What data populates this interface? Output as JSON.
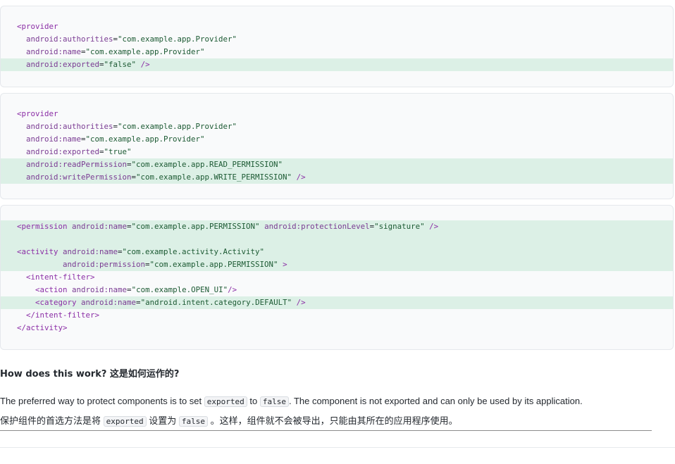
{
  "code_blocks": [
    {
      "lines": [
        {
          "indent": "",
          "parts": [
            {
              "t": "tag",
              "v": "<provider"
            }
          ],
          "hl": false
        },
        {
          "indent": "  ",
          "parts": [
            {
              "t": "attrn",
              "v": "android:authorities"
            },
            {
              "t": "punc",
              "v": "="
            },
            {
              "t": "str",
              "v": "\"com.example.app.Provider\""
            }
          ],
          "hl": false
        },
        {
          "indent": "  ",
          "parts": [
            {
              "t": "attrn",
              "v": "android:name"
            },
            {
              "t": "punc",
              "v": "="
            },
            {
              "t": "str",
              "v": "\"com.example.app.Provider\""
            }
          ],
          "hl": false
        },
        {
          "indent": "  ",
          "parts": [
            {
              "t": "attrn",
              "v": "android:exported"
            },
            {
              "t": "punc",
              "v": "="
            },
            {
              "t": "str",
              "v": "\"false\""
            },
            {
              "t": "tag",
              "v": " />"
            }
          ],
          "hl": true
        }
      ]
    },
    {
      "lines": [
        {
          "indent": "",
          "parts": [
            {
              "t": "tag",
              "v": "<provider"
            }
          ],
          "hl": false
        },
        {
          "indent": "  ",
          "parts": [
            {
              "t": "attrn",
              "v": "android:authorities"
            },
            {
              "t": "punc",
              "v": "="
            },
            {
              "t": "str",
              "v": "\"com.example.app.Provider\""
            }
          ],
          "hl": false
        },
        {
          "indent": "  ",
          "parts": [
            {
              "t": "attrn",
              "v": "android:name"
            },
            {
              "t": "punc",
              "v": "="
            },
            {
              "t": "str",
              "v": "\"com.example.app.Provider\""
            }
          ],
          "hl": false
        },
        {
          "indent": "  ",
          "parts": [
            {
              "t": "attrn",
              "v": "android:exported"
            },
            {
              "t": "punc",
              "v": "="
            },
            {
              "t": "str",
              "v": "\"true\""
            }
          ],
          "hl": false
        },
        {
          "indent": "  ",
          "parts": [
            {
              "t": "attrn",
              "v": "android:readPermission"
            },
            {
              "t": "punc",
              "v": "="
            },
            {
              "t": "str",
              "v": "\"com.example.app.READ_PERMISSION\""
            }
          ],
          "hl": true
        },
        {
          "indent": "  ",
          "parts": [
            {
              "t": "attrn",
              "v": "android:writePermission"
            },
            {
              "t": "punc",
              "v": "="
            },
            {
              "t": "str",
              "v": "\"com.example.app.WRITE_PERMISSION\""
            },
            {
              "t": "tag",
              "v": " />"
            }
          ],
          "hl": true
        }
      ]
    },
    {
      "lines": [
        {
          "indent": "",
          "parts": [
            {
              "t": "tag",
              "v": "<permission "
            },
            {
              "t": "attrn",
              "v": "android:name"
            },
            {
              "t": "punc",
              "v": "="
            },
            {
              "t": "str",
              "v": "\"com.example.app.PERMISSION\""
            },
            {
              "t": "punc",
              "v": " "
            },
            {
              "t": "attrn",
              "v": "android:protectionLevel"
            },
            {
              "t": "punc",
              "v": "="
            },
            {
              "t": "str",
              "v": "\"signature\""
            },
            {
              "t": "tag",
              "v": " />"
            }
          ],
          "hl": true
        },
        {
          "indent": "",
          "parts": [],
          "hl": true
        },
        {
          "indent": "",
          "parts": [
            {
              "t": "tag",
              "v": "<activity "
            },
            {
              "t": "attrn",
              "v": "android:name"
            },
            {
              "t": "punc",
              "v": "="
            },
            {
              "t": "str",
              "v": "\"com.example.activity.Activity\""
            }
          ],
          "hl": true
        },
        {
          "indent": "          ",
          "parts": [
            {
              "t": "attrn",
              "v": "android:permission"
            },
            {
              "t": "punc",
              "v": "="
            },
            {
              "t": "str",
              "v": "\"com.example.app.PERMISSION\""
            },
            {
              "t": "tag",
              "v": " >"
            }
          ],
          "hl": true
        },
        {
          "indent": "  ",
          "parts": [
            {
              "t": "tag",
              "v": "<intent-filter>"
            }
          ],
          "hl": false
        },
        {
          "indent": "    ",
          "parts": [
            {
              "t": "tag",
              "v": "<action "
            },
            {
              "t": "attrn",
              "v": "android:name"
            },
            {
              "t": "punc",
              "v": "="
            },
            {
              "t": "str",
              "v": "\"com.example.OPEN_UI\""
            },
            {
              "t": "tag",
              "v": "/>"
            }
          ],
          "hl": false
        },
        {
          "indent": "    ",
          "parts": [
            {
              "t": "tag",
              "v": "<category "
            },
            {
              "t": "attrn",
              "v": "android:name"
            },
            {
              "t": "punc",
              "v": "="
            },
            {
              "t": "str",
              "v": "\"android.intent.category.DEFAULT\""
            },
            {
              "t": "tag",
              "v": " />"
            }
          ],
          "hl": true
        },
        {
          "indent": "  ",
          "parts": [
            {
              "t": "tag",
              "v": "</intent-filter>"
            }
          ],
          "hl": false
        },
        {
          "indent": "",
          "parts": [
            {
              "t": "tag",
              "v": "</activity>"
            }
          ],
          "hl": false
        }
      ]
    }
  ],
  "heading": "How does this work?  这是如何运作的?",
  "paragraph_en": {
    "before": "The preferred way to protect components is to set ",
    "code1": "exported",
    "mid": " to ",
    "code2": "false",
    "after": ". The component is not exported and can only be used by its application."
  },
  "paragraph_zh": {
    "before": "保护组件的首选方法是将 ",
    "code1": "exported",
    "mid": " 设置为 ",
    "code2": "false",
    "after": " 。这样，组件就不会被导出，只能由其所在的应用程序使用。"
  },
  "colors": {
    "highlight": "#dcf0e6",
    "tag": "#8b2ea6",
    "string": "#1c5a33"
  }
}
